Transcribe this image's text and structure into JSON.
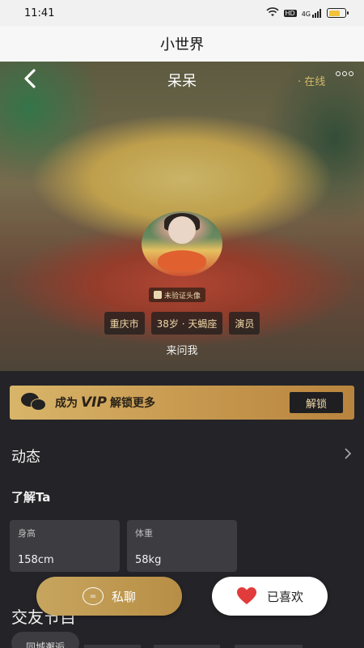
{
  "status_bar": {
    "time": "11:41",
    "network": "4G",
    "hd": "HD"
  },
  "app": {
    "title": "小世界"
  },
  "profile": {
    "name": "呆呆",
    "online": "· 在线",
    "verify_badge": "未验证头像",
    "tags": [
      "重庆市",
      "38岁 · 天蝎座",
      "演员"
    ],
    "motto": "来问我"
  },
  "vip_banner": {
    "prefix": "成为",
    "vip": "VIP",
    "suffix": "解锁更多",
    "button": "解锁"
  },
  "sections": {
    "moments": "动态",
    "about": "了解Ta",
    "dating": "交友节目"
  },
  "stats": [
    {
      "label": "身高",
      "value": "158cm"
    },
    {
      "label": "体重",
      "value": "58kg"
    }
  ],
  "dating_chip": "同城邂逅",
  "actions": {
    "chat": "私聊",
    "like": "已喜欢"
  },
  "colors": {
    "accent_gold": "#c9a45c",
    "heart_red": "#e23b3b",
    "background": "#242428"
  },
  "icons": {
    "back": "chevron-left-icon",
    "more": "more-icon",
    "chat": "chat-bubble-icon",
    "heart": "heart-icon",
    "wechat": "wechat-icon"
  }
}
